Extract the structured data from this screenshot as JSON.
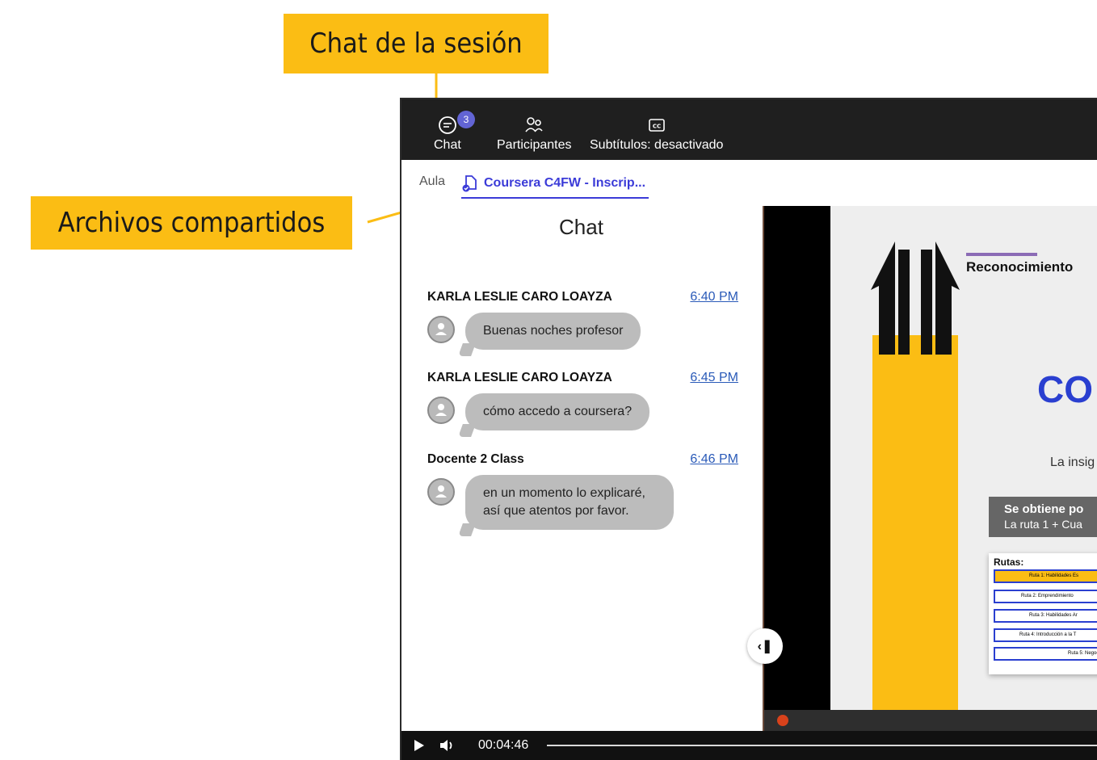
{
  "callouts": {
    "chat_session": "Chat de la sesión",
    "shared_files": "Archivos compartidos"
  },
  "toolbar": {
    "chat_label": "Chat",
    "chat_badge": "3",
    "participants_label": "Participantes",
    "subtitles_label": "Subtítulos: desactivado"
  },
  "tabs": {
    "aula": "Aula",
    "file": "Coursera C4FW - Inscrip..."
  },
  "chat": {
    "title": "Chat",
    "messages": [
      {
        "author": "KARLA LESLIE CARO LOAYZA",
        "time": "6:40 PM",
        "text": "Buenas noches profesor"
      },
      {
        "author": "KARLA LESLIE CARO LOAYZA",
        "time": "6:45 PM",
        "text": "cómo accedo a coursera?"
      },
      {
        "author": "Docente 2 Class",
        "time": "6:46 PM",
        "text": "en un momento lo explicaré, así que atentos por favor."
      }
    ]
  },
  "slide": {
    "header": "Reconocimiento",
    "big_text": "CO",
    "subtitle": "La insig",
    "box_title": "Se obtiene po",
    "box_sub": "La ruta 1 + Cua",
    "rutas_label": "Rutas:",
    "rutas": [
      "Ruta 1: Habilidades Es",
      "Ruta 2: Emprendimiento",
      "Ruta 3: Habilidades Ar",
      "Ruta 4: Introducción a la T",
      "Ruta 5: Negoc"
    ]
  },
  "player": {
    "time": "00:04:46"
  },
  "colors": {
    "callout": "#fbbd14",
    "accent": "#3b3bd8",
    "badge": "#6264d4"
  }
}
